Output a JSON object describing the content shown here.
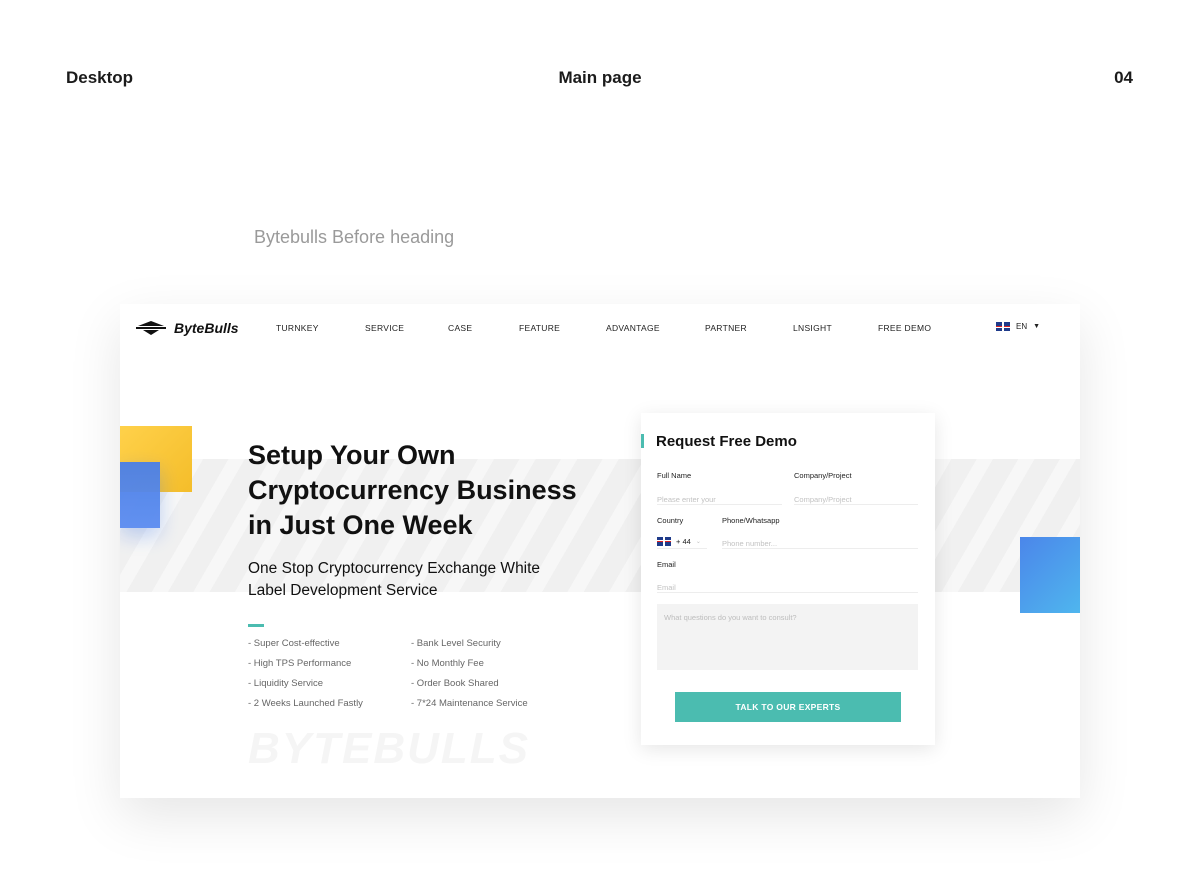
{
  "presentation": {
    "left_label": "Desktop",
    "center_label": "Main page",
    "page_number": "04",
    "before_heading": "Bytebulls Before heading"
  },
  "nav": {
    "logo_text": "ByteBulls",
    "items": [
      "TURNKEY",
      "SERVICE",
      "CASE",
      "FEATURE",
      "ADVANTAGE",
      "PARTNER",
      "LNSIGHT",
      "FREE DEMO"
    ],
    "language": "EN"
  },
  "hero": {
    "title_lines": [
      "Setup Your Own",
      "Cryptocurrency Business",
      "in Just One Week"
    ],
    "subtitle_lines": [
      "One Stop Cryptocurrency Exchange White",
      "Label Development Service"
    ],
    "features_left": [
      "- Super Cost-effective",
      "- High TPS Performance",
      "- Liquidity Service",
      "- 2 Weeks Launched Fastly"
    ],
    "features_right": [
      "- Bank Level Security",
      "- No Monthly Fee",
      "- Order Book Shared",
      "- 7*24 Maintenance Service"
    ],
    "watermark": "BYTEBULLS"
  },
  "form": {
    "title": "Request Free Demo",
    "full_name_label": "Full Name",
    "full_name_placeholder": "Please enter your",
    "company_label": "Company/Project",
    "company_placeholder": "Company/Project",
    "country_label": "Country",
    "country_code": "+ 44",
    "phone_label": "Phone/Whatsapp",
    "phone_placeholder": "Phone number...",
    "email_label": "Email",
    "email_placeholder": "Email",
    "question_placeholder": "What questions do you want to consult?",
    "submit_label": "TALK TO OUR EXPERTS"
  },
  "colors": {
    "accent": "#4bbcb0",
    "yellow": "#ffd14a",
    "blue": "#4a7fe8"
  }
}
